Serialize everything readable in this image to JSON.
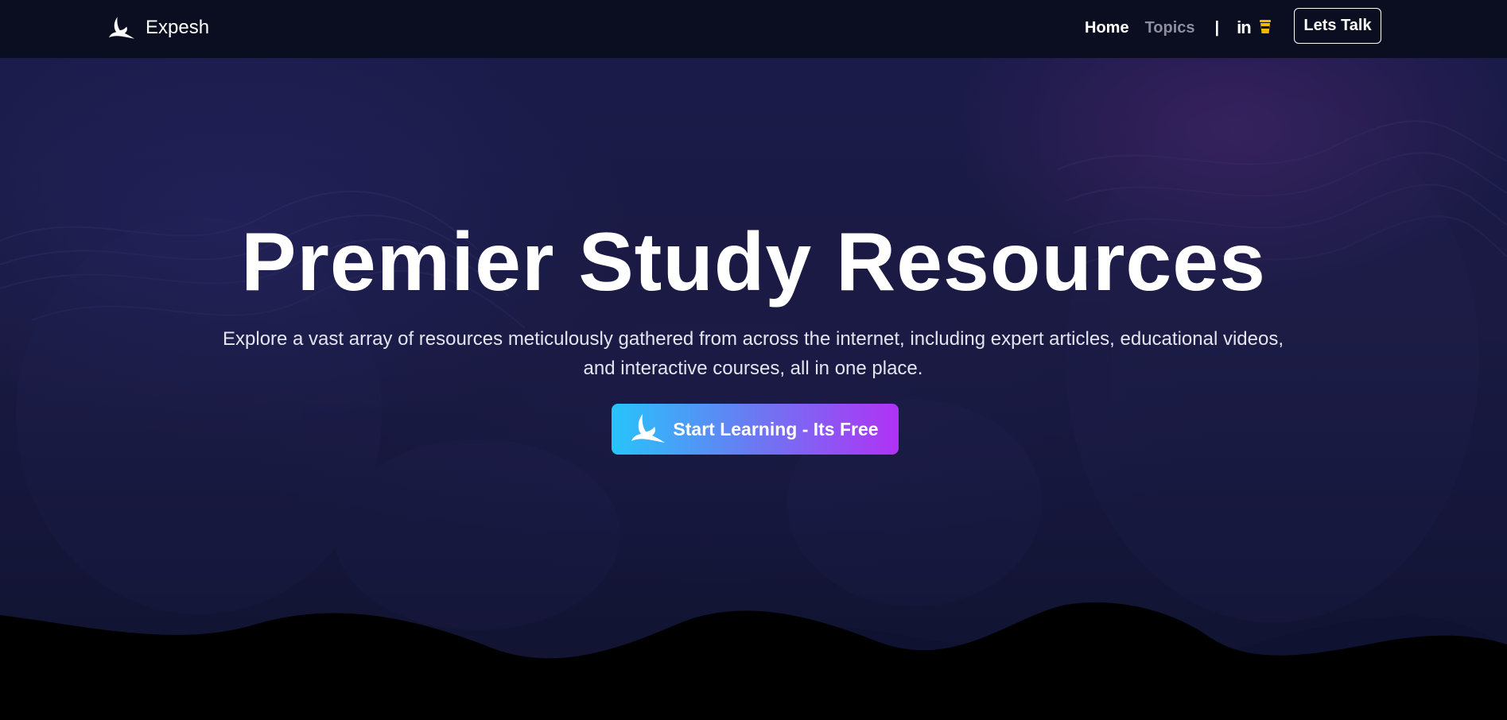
{
  "navbar": {
    "brand_name": "Expesh",
    "links": [
      {
        "label": "Home"
      },
      {
        "label": "Topics"
      }
    ],
    "divider": "|",
    "linkedin_label": "in",
    "cta_label": "Lets Talk"
  },
  "hero": {
    "title": "Premier Study Resources",
    "subtitle": "Explore a vast array of resources meticulously gathered from across the internet, including expert articles, educational videos, and interactive courses, all in one place.",
    "cta_label": "Start Learning - Its Free"
  },
  "icons": {
    "brand": "bird-logo-icon",
    "linkedin": "linkedin-icon",
    "coffee": "coffee-cup-icon",
    "cta": "bird-icon"
  },
  "colors": {
    "nav_bg": "#0a0e20",
    "hero_bg": "#1b1b4a",
    "cta_gradient_start": "#27c4fb",
    "cta_gradient_end": "#b032f5",
    "coffee_icon": "#f5b800",
    "topics_link": "#8c8e9e"
  }
}
